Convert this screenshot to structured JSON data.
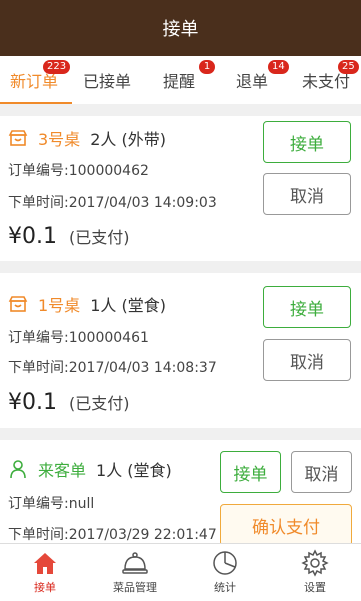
{
  "header": {
    "title": "接单"
  },
  "tabs": [
    {
      "label": "新订单",
      "badge": "223"
    },
    {
      "label": "已接单",
      "badge": ""
    },
    {
      "label": "提醒",
      "badge": "1"
    },
    {
      "label": "退单",
      "badge": "14"
    },
    {
      "label": "未支付",
      "badge": "25"
    }
  ],
  "orders": [
    {
      "table": "3号桌",
      "people": "2人 (外带)",
      "order_no": "订单编号:100000462",
      "time": "下单时间:2017/04/03 14:09:03",
      "price": "¥0.1",
      "paid": "(已支付)",
      "accept": "接单",
      "cancel": "取消"
    },
    {
      "table": "1号桌",
      "people": "1人 (堂食)",
      "order_no": "订单编号:100000461",
      "time": "下单时间:2017/04/03 14:08:37",
      "price": "¥0.1",
      "paid": "(已支付)",
      "accept": "接单",
      "cancel": "取消"
    },
    {
      "table": "来客单",
      "people": "1人 (堂食)",
      "order_no": "订单编号:null",
      "time": "下单时间:2017/03/29 22:01:47",
      "accept": "接单",
      "cancel": "取消",
      "confirm_pay": "确认支付"
    }
  ],
  "nav": [
    {
      "label": "接单",
      "icon": "home-icon"
    },
    {
      "label": "菜品管理",
      "icon": "dish-cover-icon"
    },
    {
      "label": "统计",
      "icon": "pie-chart-icon"
    },
    {
      "label": "设置",
      "icon": "gear-icon"
    }
  ],
  "colors": {
    "header": "#4a2f1c",
    "accent": "#f08a2a",
    "green": "#3dad3d",
    "badge": "#d9271c"
  }
}
